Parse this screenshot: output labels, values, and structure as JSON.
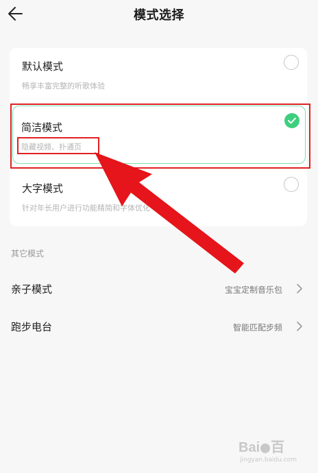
{
  "header": {
    "title": "模式选择",
    "back_icon": "arrow-left-icon"
  },
  "modes": [
    {
      "name": "默认模式",
      "desc": "畅享丰富完整的听歌体验",
      "selected": false
    },
    {
      "name": "简洁模式",
      "desc": "隐藏视频、扑通页",
      "selected": true
    },
    {
      "name": "大字模式",
      "desc": "针对年长用户进行功能精简和字体优化",
      "selected": false
    }
  ],
  "other": {
    "section_label": "其它模式",
    "items": [
      {
        "label": "亲子模式",
        "value": "宝宝定制音乐包"
      },
      {
        "label": "跑步电台",
        "value": "智能匹配步频"
      }
    ]
  },
  "colors": {
    "accent_green": "#3ecf7e",
    "selection_border": "#7fe0a9",
    "annotation_red": "#e02020"
  },
  "watermark": {
    "logo_left": "Bai",
    "logo_right": "百",
    "url": "jingyan.baidu.com"
  }
}
